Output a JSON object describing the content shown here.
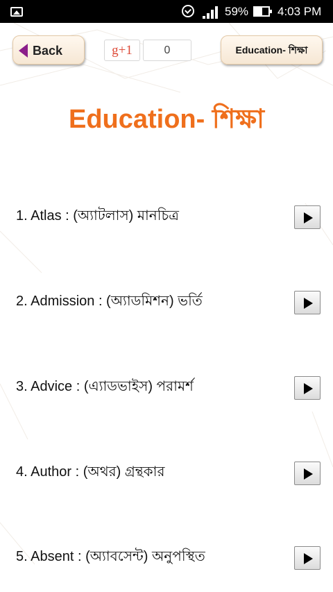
{
  "status_bar": {
    "battery": "59%",
    "time": "4:03 PM",
    "icons": [
      "gallery-icon",
      "alarm-icon",
      "signal-icon",
      "battery-icon"
    ]
  },
  "header": {
    "back_label": "Back",
    "gplus_label": "g+1",
    "gplus_count": "0",
    "topic_label": "Education- শিক্ষা"
  },
  "page_title": "Education- শিক্ষা",
  "words": [
    {
      "text": "1. Atlas : (অ্যাটলাস) মানচিত্র"
    },
    {
      "text": " 2. Admission : (অ্যাডমিশন) ভর্তি"
    },
    {
      "text": "3. Advice : (এ্যাডভাইস) পরামর্শ"
    },
    {
      "text": "4. Author : (অথর) গ্রন্থকার"
    },
    {
      "text": "5. Absent : (অ্যাবসেন্ট) অনুপস্থিত"
    }
  ],
  "colors": {
    "title": "#ef6f1c",
    "back_arrow": "#8b1e8a",
    "gplus": "#dd4b39"
  }
}
